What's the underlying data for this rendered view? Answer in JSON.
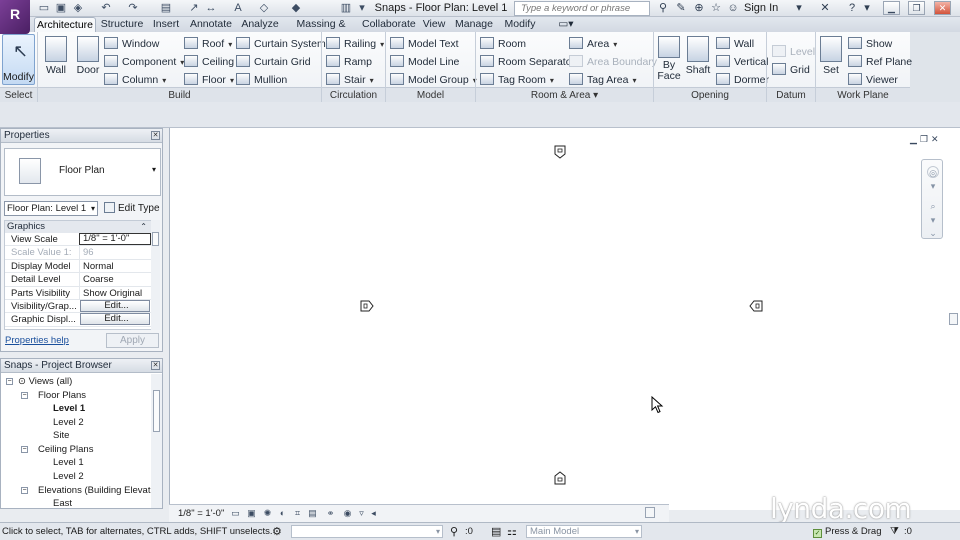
{
  "app": {
    "logo_letter": "R",
    "title": "Snaps - Floor Plan: Level 1",
    "search_placeholder": "Type a keyword or phrase",
    "sign_in": "Sign In"
  },
  "ribbon_tabs": [
    "Architecture",
    "Structure",
    "Insert",
    "Annotate",
    "Analyze",
    "Massing & Site",
    "Collaborate",
    "View",
    "Manage",
    "Modify"
  ],
  "ribbon": {
    "select": {
      "modify": "Modify",
      "panel": "Select"
    },
    "build": {
      "wall": "Wall",
      "door": "Door",
      "window": "Window",
      "component": "Component",
      "column": "Column",
      "roof": "Roof",
      "ceiling": "Ceiling",
      "floor": "Floor",
      "curtain_system": "Curtain System",
      "curtain_grid": "Curtain Grid",
      "mullion": "Mullion",
      "panel": "Build"
    },
    "circulation": {
      "railing": "Railing",
      "ramp": "Ramp",
      "stair": "Stair",
      "panel": "Circulation"
    },
    "model": {
      "model_text": "Model Text",
      "model_line": "Model Line",
      "model_group": "Model Group",
      "panel": "Model"
    },
    "room_area": {
      "room": "Room",
      "room_separator": "Room Separator",
      "tag_room": "Tag Room",
      "area": "Area",
      "area_boundary": "Area Boundary",
      "tag_area": "Tag Area",
      "panel": "Room & Area"
    },
    "opening": {
      "by_face_1": "By",
      "by_face_2": "Face",
      "shaft": "Shaft",
      "wall": "Wall",
      "vertical": "Vertical",
      "dormer": "Dormer",
      "panel": "Opening"
    },
    "datum": {
      "level": "Level",
      "grid": "Grid",
      "panel": "Datum"
    },
    "work_plane": {
      "set": "Set",
      "show": "Show",
      "ref_plane": "Ref Plane",
      "viewer": "Viewer",
      "panel": "Work Plane"
    }
  },
  "properties": {
    "title": "Properties",
    "type_name": "Floor Plan",
    "instance": "Floor Plan: Level 1",
    "edit_type": "Edit Type",
    "group": "Graphics",
    "rows": [
      {
        "k": "View Scale",
        "v": "1/8\" = 1'-0\""
      },
      {
        "k": "Scale Value    1:",
        "v": "96"
      },
      {
        "k": "Display Model",
        "v": "Normal"
      },
      {
        "k": "Detail Level",
        "v": "Coarse"
      },
      {
        "k": "Parts Visibility",
        "v": "Show Original"
      },
      {
        "k": "Visibility/Grap...",
        "v": "Edit..."
      },
      {
        "k": "Graphic Displ...",
        "v": "Edit..."
      }
    ],
    "help": "Properties help",
    "apply": "Apply"
  },
  "browser": {
    "title": "Snaps - Project Browser",
    "items": [
      {
        "label": "Views (all)"
      },
      {
        "label": "Floor Plans"
      },
      {
        "label": "Level 1"
      },
      {
        "label": "Level 2"
      },
      {
        "label": "Site"
      },
      {
        "label": "Ceiling Plans"
      },
      {
        "label": "Level 1"
      },
      {
        "label": "Level 2"
      },
      {
        "label": "Elevations (Building Elevatio"
      },
      {
        "label": "East"
      }
    ]
  },
  "view_bar": {
    "scale": "1/8\" = 1'-0\""
  },
  "status": {
    "hint": "Click to select, TAB for alternates, CTRL adds, SHIFT unselects.",
    "count": ":0",
    "model": "Main Model",
    "press_drag": "Press & Drag"
  },
  "watermark": "lynda.com"
}
